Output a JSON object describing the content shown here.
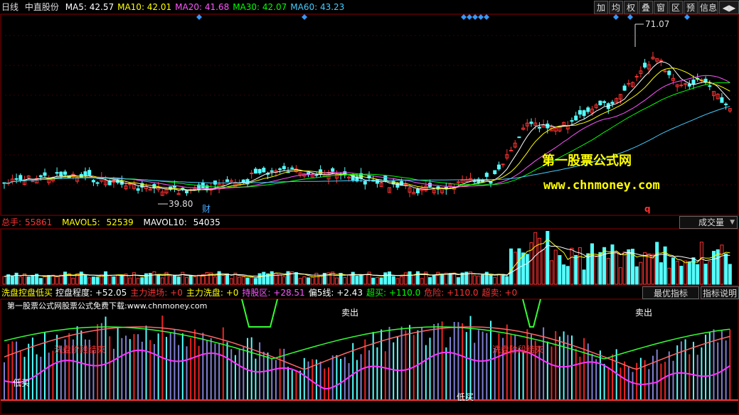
{
  "header": {
    "period": "日线",
    "stock_name": "中直股份",
    "ma": [
      {
        "label": "MA5:",
        "value": "42.57",
        "color": "#ffffff"
      },
      {
        "label": "MA10:",
        "value": "42.01",
        "color": "#ffff00"
      },
      {
        "label": "MA20:",
        "value": "41.68",
        "color": "#ff55ff"
      },
      {
        "label": "MA30:",
        "value": "42.07",
        "color": "#00ff00"
      },
      {
        "label": "MA60:",
        "value": "43.23",
        "color": "#44ccff"
      }
    ]
  },
  "toolbar": [
    "加",
    "均",
    "权",
    "叠",
    "窗",
    "区",
    "预",
    "信息",
    "◀▶"
  ],
  "price_chart": {
    "high_label": "71.07",
    "low_label": "39.80",
    "cai_label": "财",
    "q_label": "q",
    "watermark_title": "第一股票公式网",
    "watermark_url": "www.chnmoney.com"
  },
  "volume": {
    "total_label": "总手:",
    "total_value": "55861",
    "mavol5_label": "MAVOL5:",
    "mavol5_value": "52539",
    "mavol10_label": "MAVOL10:",
    "mavol10_value": "54035",
    "select": "成交量"
  },
  "indicator": {
    "name": "洗盘控盘低买",
    "items": [
      {
        "label": "控盘程度:",
        "value": "+52.05",
        "color": "#ffffff"
      },
      {
        "label": "主力进场:",
        "value": "+0",
        "color": "#ff3333"
      },
      {
        "label": "主力洗盘:",
        "value": "+0",
        "color": "#ffff00"
      },
      {
        "label": "持股区:",
        "value": "+28.51",
        "color": "#ff55ff"
      },
      {
        "label": "偏5线:",
        "value": "+2.43",
        "color": "#ffffff"
      },
      {
        "label": "超买:",
        "value": "+110.0",
        "color": "#00ff00"
      },
      {
        "label": "危险:",
        "value": "+110.0",
        "color": "#ff3333"
      },
      {
        "label": "超卖:",
        "value": "+0",
        "color": "#ff3333"
      }
    ],
    "buttons": [
      "最优指标",
      "指标说明"
    ],
    "caption": "第一股票公式网股票公式免费下载:www.chnmoney.com",
    "labels": {
      "sell": "卖出",
      "wash_end": "洗盘阶段结束",
      "low_buy": "低买"
    }
  },
  "colors": {
    "up": "#ff3232",
    "down": "#54ffff",
    "grid": "#8b0000"
  }
}
